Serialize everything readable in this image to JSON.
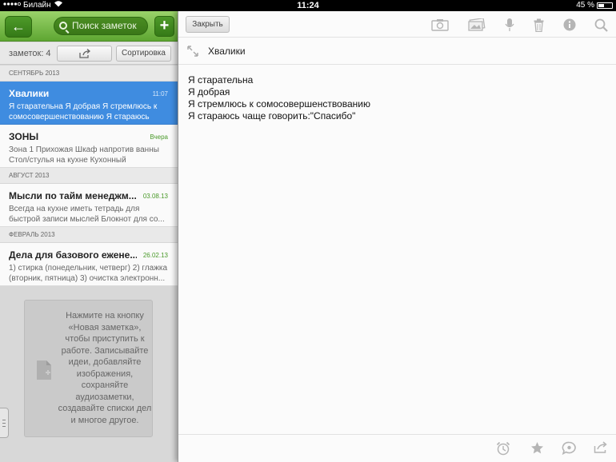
{
  "status_bar": {
    "carrier": "Билайн",
    "time": "11:24",
    "battery": "45 %",
    "battery_level": 0.45
  },
  "sidebar": {
    "search_placeholder": "Поиск заметок",
    "notes_count": "заметок: 4",
    "sort_label": "Сортировка",
    "sections": [
      {
        "label": "СЕНТЯБРЬ 2013",
        "notes": [
          {
            "title": "Хвалики",
            "date": "11:07",
            "snippet": "Я старательна Я добрая Я стремлюсь к сомосовершенствованию Я стараюсь чаще",
            "selected": true
          }
        ]
      },
      {
        "label": "",
        "notes": [
          {
            "title": "ЗОНЫ",
            "date": "Вчера",
            "snippet": "Зона 1 Прихожая Шкаф напротив ванны Стол/стулья на кухне Кухонный подоконник",
            "selected": false
          }
        ]
      },
      {
        "label": "АВГУСТ 2013",
        "notes": [
          {
            "title": "Мысли по тайм менеджм...",
            "date": "03.08.13",
            "snippet": "Всегда на кухне иметь тетрадь для быстрой записи мыслей Блокнот для со...",
            "selected": false
          }
        ]
      },
      {
        "label": "ФЕВРАЛЬ 2013",
        "notes": [
          {
            "title": "Дела для базового ежене...",
            "date": "26.02.13",
            "snippet": "1) стирка (понедельник, четверг) 2) глажка (вторник, пятница) 3) очистка электронн...",
            "selected": false
          }
        ]
      }
    ],
    "empty_hint": "Нажмите на кнопку «Новая заметка», чтобы приступить к работе. Записывайте идеи, добавляйте изображения, сохраняйте аудиозаметки, создавайте списки дел и многое другое."
  },
  "editor": {
    "close_label": "Закрыть",
    "toolbar_icons": [
      "camera-icon",
      "photo-icon",
      "microphone-icon",
      "trash-icon",
      "info-icon",
      "search-icon"
    ],
    "note_title": "Хвалики",
    "body_lines": [
      "Я старательна",
      "Я добрая",
      "Я стремлюсь к сомосовершенствованию",
      "Я стараюсь чаще говорить:\"Спасибо\""
    ],
    "bottom_icons": [
      "alarm-icon",
      "star-icon",
      "chat-icon",
      "share-icon"
    ]
  },
  "colors": {
    "accent_green": "#5ea632",
    "selection_blue": "#3f8ce0",
    "date_green": "#4a9a2a"
  }
}
